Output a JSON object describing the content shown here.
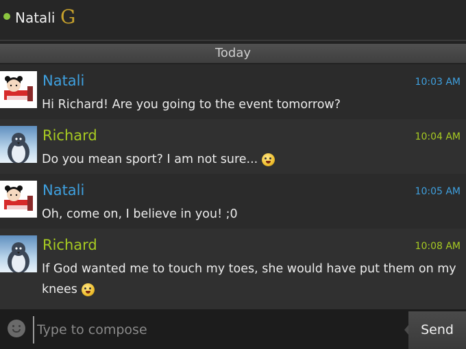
{
  "header": {
    "contact_name": "Natali",
    "status": "online",
    "status_color": "#8bc53f",
    "service_icon": "gtalk-icon",
    "service_glyph": "G"
  },
  "date_separator": "Today",
  "messages": [
    {
      "sender": "Natali",
      "time": "10:03 AM",
      "text": "Hi Richard! Are you going to the event tomorrow?",
      "avatar": "pucca-avatar",
      "emoji": ""
    },
    {
      "sender": "Richard",
      "time": "10:04 AM",
      "text": "Do you mean sport? I am not sure...",
      "avatar": "penguin-avatar",
      "emoji": "shocked-emoji"
    },
    {
      "sender": "Natali",
      "time": "10:05 AM",
      "text": "Oh, come on, I believe in you! ;0",
      "avatar": "pucca-avatar",
      "emoji": ""
    },
    {
      "sender": "Richard",
      "time": "10:08 AM",
      "text": "If God wanted me to touch my toes, she would have put them on my knees",
      "avatar": "penguin-avatar",
      "emoji": "laughing-emoji"
    }
  ],
  "compose": {
    "placeholder": "Type to compose",
    "value": "",
    "emoji_button_icon": "smiley-icon",
    "send_label": "Send"
  },
  "colors": {
    "natali": "#3fa1e0",
    "richard": "#a7cb22"
  }
}
